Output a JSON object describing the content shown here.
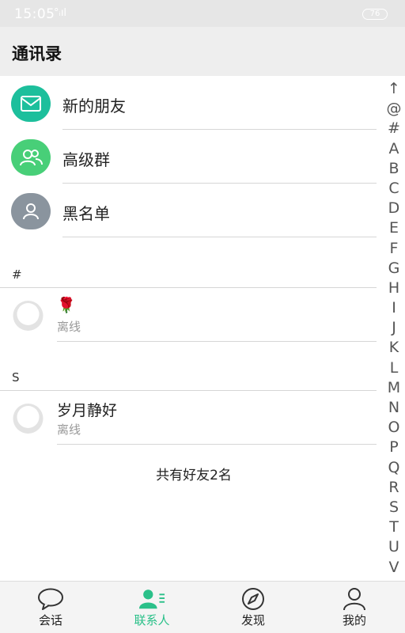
{
  "status_bar": {
    "time": "15:05",
    "signal": "°ᵢıl",
    "battery": "76"
  },
  "header": {
    "title": "通讯录"
  },
  "functions": [
    {
      "label": "新的朋友",
      "icon": "mail-icon",
      "color": "#1dbf9c"
    },
    {
      "label": "高级群",
      "icon": "group-icon",
      "color": "#48cf78"
    },
    {
      "label": "黑名单",
      "icon": "person-icon",
      "color": "#8a949e"
    }
  ],
  "sections": [
    {
      "letter": "#",
      "contacts": [
        {
          "name": "🌹",
          "status": "离线"
        }
      ]
    },
    {
      "letter": "S",
      "contacts": [
        {
          "name": "岁月静好",
          "status": "离线"
        }
      ]
    }
  ],
  "footer": {
    "count_text": "共有好友2名"
  },
  "alpha_index": [
    "↑",
    "@",
    "#",
    "A",
    "B",
    "C",
    "D",
    "E",
    "F",
    "G",
    "H",
    "I",
    "J",
    "K",
    "L",
    "M",
    "N",
    "O",
    "P",
    "Q",
    "R",
    "S",
    "T",
    "U",
    "V"
  ],
  "nav": [
    {
      "label": "会话",
      "icon": "chat-bubble-icon",
      "active": false
    },
    {
      "label": "联系人",
      "icon": "contacts-icon",
      "active": true
    },
    {
      "label": "发现",
      "icon": "compass-icon",
      "active": false
    },
    {
      "label": "我的",
      "icon": "profile-icon",
      "active": false
    }
  ],
  "colors": {
    "accent": "#2ac089",
    "divider": "#d6d6d6"
  }
}
